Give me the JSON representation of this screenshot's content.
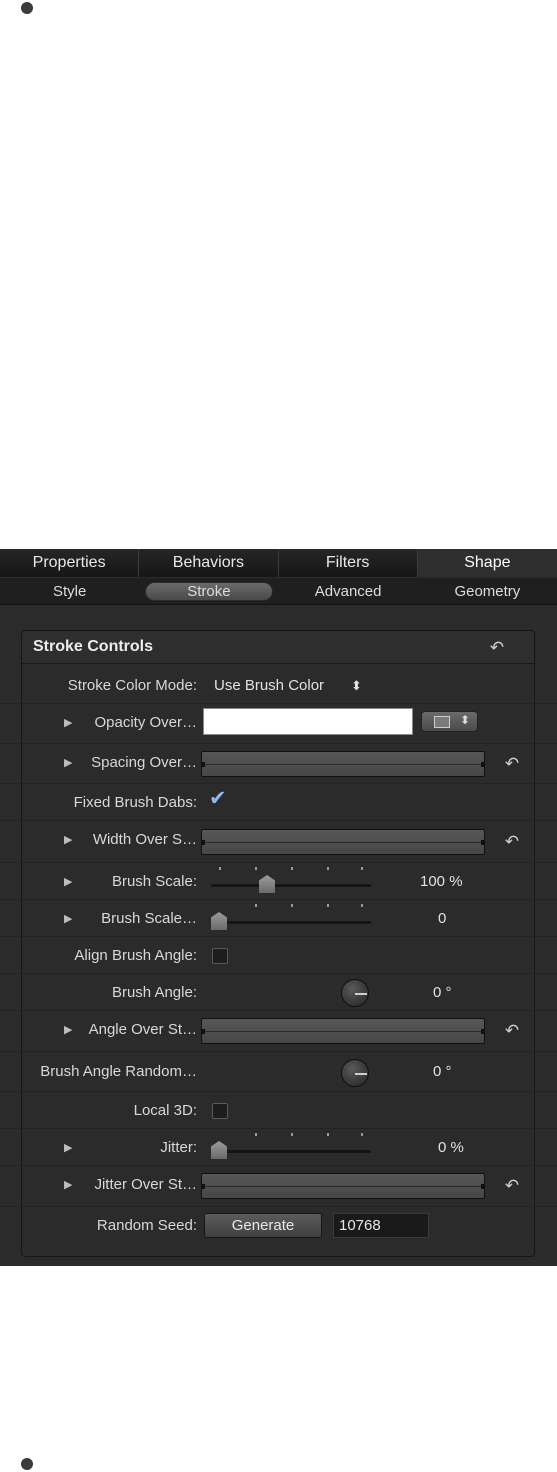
{
  "tabs": [
    "Properties",
    "Behaviors",
    "Filters",
    "Shape"
  ],
  "active_tab": "Shape",
  "subtabs": [
    "Style",
    "Stroke",
    "Advanced",
    "Geometry"
  ],
  "active_subtab": "Stroke",
  "group": {
    "title": "Stroke Controls"
  },
  "rows": {
    "stroke_color_mode": {
      "label": "Stroke Color Mode:",
      "value": "Use Brush Color",
      "arrows": "⬍"
    },
    "opacity_over": {
      "label": "Opacity Over…"
    },
    "spacing_over": {
      "label": "Spacing Over…"
    },
    "fixed_brush_dabs": {
      "label": "Fixed Brush Dabs:",
      "checked": true
    },
    "width_over": {
      "label": "Width Over S…"
    },
    "brush_scale": {
      "label": "Brush Scale:",
      "value": "100 %",
      "level": 0.3
    },
    "brush_scale_rand": {
      "label": "Brush Scale…",
      "value": "0",
      "level": 0.0
    },
    "align_brush_angle": {
      "label": "Align Brush Angle:",
      "checked": false
    },
    "brush_angle": {
      "label": "Brush Angle:",
      "value": "0 °"
    },
    "angle_over": {
      "label": "Angle Over St…"
    },
    "brush_angle_random": {
      "label": "Brush Angle Random…",
      "value": "0 °"
    },
    "local_3d": {
      "label": "Local 3D:",
      "checked": false
    },
    "jitter": {
      "label": "Jitter:",
      "value": "0 %",
      "level": 0.0
    },
    "jitter_over": {
      "label": "Jitter Over St…"
    },
    "random_seed": {
      "label": "Random Seed:",
      "button": "Generate",
      "value": "10768"
    }
  },
  "icons": {
    "disclosure": "▶",
    "reset": "↶",
    "check": "✔"
  }
}
